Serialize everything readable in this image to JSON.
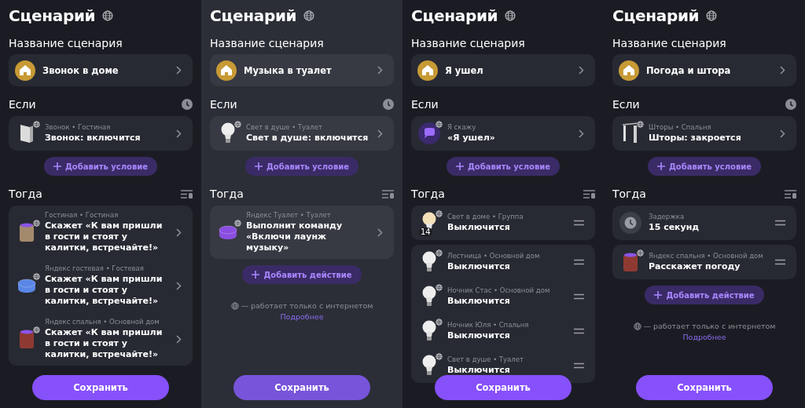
{
  "panels": [
    {
      "dimmed": false,
      "title": "Сценарий",
      "name_label": "Название сценария",
      "name": "Звонок в доме",
      "if_label": "Если",
      "if_timer": true,
      "conditions": [
        {
          "kind": "doorbell",
          "online": true,
          "meta": "Звонок • Гостиная",
          "text": "Звонок: включится",
          "draggable": false
        }
      ],
      "add_condition": "Добавить условие",
      "then_label": "Тогда",
      "action_groups": [
        {
          "items": [
            {
              "kind": "speaker",
              "color": "#a48a6c",
              "online": true,
              "meta": "Гостиная • Гостиная",
              "text": "Скажет «К вам пришли в гости и стоят у калитки, встречайте!»",
              "draggable": false
            },
            {
              "kind": "puck",
              "color": "#5a86e6",
              "online": true,
              "meta": "Яндекс гостевая • Гостевая",
              "text": "Скажет «К вам пришли в гости и стоят у калитки, встречайте!»",
              "draggable": false
            },
            {
              "kind": "speaker",
              "color": "#8e3a33",
              "online": true,
              "meta": "Яндекс спальня • Основной дом",
              "text": "Скажет «К вам пришли в гости и стоят у калитки, встречайте!»",
              "draggable": false
            }
          ]
        }
      ],
      "save": "Сохранить"
    },
    {
      "dimmed": true,
      "title": "Сценарий",
      "name_label": "Название сценария",
      "name": "Музыка в туалет",
      "if_label": "Если",
      "if_timer": true,
      "conditions": [
        {
          "kind": "bulb",
          "online": true,
          "meta": "Свет в душе • Туалет",
          "text": "Свет в душе: включится",
          "draggable": false
        }
      ],
      "add_condition": "Добавить условие",
      "then_label": "Тогда",
      "action_groups": [
        {
          "items": [
            {
              "kind": "puck",
              "color": "#8a4fe0",
              "online": true,
              "meta": "Яндекс Туалет • Туалет",
              "text": "Выполнит команду «Включи лаунж музыку»",
              "draggable": false
            }
          ]
        }
      ],
      "add_action": "Добавить действие",
      "note": "— работает только с интернетом",
      "note_link": "Подробнее",
      "save": "Сохранить"
    },
    {
      "dimmed": false,
      "title": "Сценарий",
      "name_label": "Название сценария",
      "name": "Я ушел",
      "if_label": "Если",
      "if_timer": false,
      "conditions": [
        {
          "kind": "speech",
          "online": true,
          "meta": "Я скажу",
          "text": "«Я ушел»",
          "draggable": false
        }
      ],
      "add_condition": "Добавить условие",
      "then_label": "Тогда",
      "action_groups": [
        {
          "items": [
            {
              "kind": "bulbs",
              "online": true,
              "badge": "14",
              "meta": "Свет в доме • Группа",
              "text": "Выключится",
              "draggable": true
            }
          ]
        },
        {
          "items": [
            {
              "kind": "bulb",
              "online": true,
              "meta": "Лестница • Основной дом",
              "text": "Выключится",
              "draggable": true
            },
            {
              "kind": "bulb",
              "online": true,
              "meta": "Ночник Стас • Основной дом",
              "text": "Выключится",
              "draggable": true
            },
            {
              "kind": "bulb",
              "online": true,
              "meta": "Ночник Юля • Спальня",
              "text": "Выключится",
              "draggable": true
            },
            {
              "kind": "bulb",
              "online": true,
              "meta": "Свет в душе • Туалет",
              "text": "Выключится",
              "draggable": true
            }
          ]
        }
      ],
      "save": "Сохранить"
    },
    {
      "dimmed": false,
      "title": "Сценарий",
      "name_label": "Название сценария",
      "name": "Погода и штора",
      "if_label": "Если",
      "if_timer": true,
      "conditions": [
        {
          "kind": "curtain",
          "online": true,
          "meta": "Шторы • Спальня",
          "text": "Шторы: закроется",
          "draggable": false
        }
      ],
      "add_condition": "Добавить условие",
      "then_label": "Тогда",
      "action_groups": [
        {
          "items": [
            {
              "kind": "clock",
              "online": false,
              "meta": "Задержка",
              "text": "15 секунд",
              "draggable": true
            }
          ]
        },
        {
          "items": [
            {
              "kind": "speaker",
              "color": "#8e3a33",
              "online": true,
              "meta": "Яндекс спальня • Основной дом",
              "text": "Расскажет погоду",
              "draggable": true
            }
          ]
        }
      ],
      "add_action": "Добавить действие",
      "note": "— работает только с интернетом",
      "note_link": "Подробнее",
      "save": "Сохранить"
    }
  ]
}
